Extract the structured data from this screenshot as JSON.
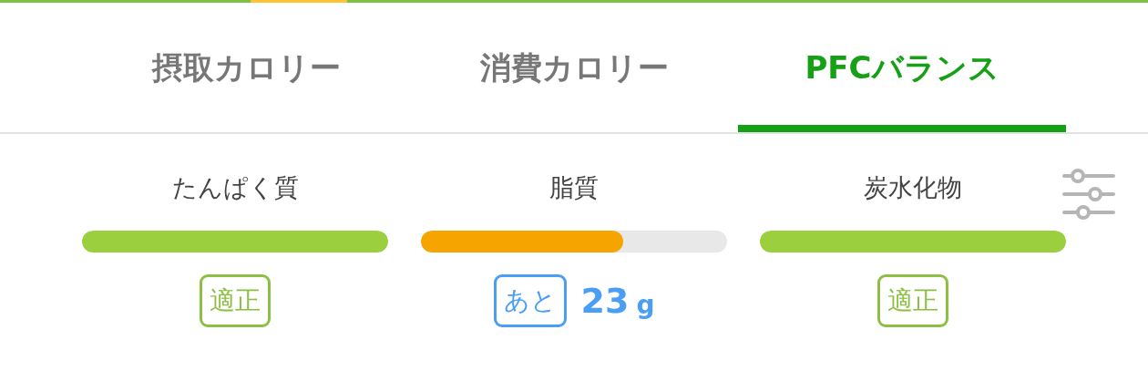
{
  "tabs": [
    {
      "label": "摂取カロリー",
      "selected": false
    },
    {
      "label": "消費カロリー",
      "selected": false
    },
    {
      "label": "PFCバランス",
      "selected": true
    }
  ],
  "nutrients": [
    {
      "name": "たんぱく質",
      "level": 1,
      "color": "#9bcf3e",
      "kind": "badge",
      "badge": "適正"
    },
    {
      "name": "脂質",
      "level": 0.66,
      "color": "#f5a400",
      "kind": "remaining",
      "badge": "あと",
      "amount": "23",
      "unit": "g"
    },
    {
      "name": "炭水化物",
      "level": 1,
      "color": "#9bcf3e",
      "kind": "badge",
      "badge": "適正"
    }
  ]
}
